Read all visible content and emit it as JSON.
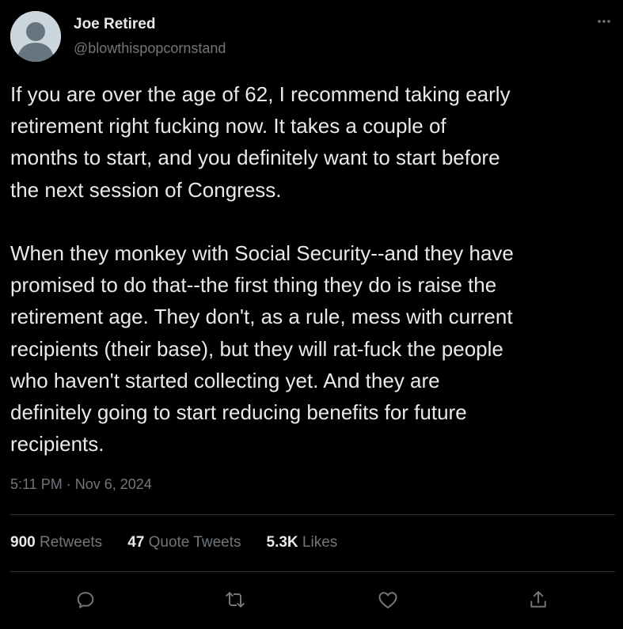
{
  "author": {
    "display_name": "Joe Retired",
    "handle": "@blowthispopcornstand",
    "avatar_icon": "default-avatar-icon"
  },
  "tweet": {
    "text": "If you are over the age of 62, I recommend taking early\nretirement right fucking now. It takes a couple of\nmonths to start, and you definitely want to start before\nthe next session of Congress.\n\nWhen they monkey with Social Security--and they have\npromised to do that--the first thing they do is raise the\nretirement age. They don't, as a rule, mess with current\nrecipients (their base), but they will rat-fuck the people\nwho haven't started collecting yet. And they are\ndefinitely going to start reducing benefits for future\nrecipients.",
    "timestamp": "5:11 PM · Nov 6, 2024"
  },
  "stats": {
    "retweets_count": "900",
    "retweets_label": "Retweets",
    "quotes_count": "47",
    "quotes_label": "Quote Tweets",
    "likes_count": "5.3K",
    "likes_label": "Likes"
  },
  "actions": {
    "reply_icon": "reply-icon",
    "retweet_icon": "retweet-icon",
    "like_icon": "heart-icon",
    "share_icon": "share-icon",
    "more_icon": "more-options-icon"
  },
  "colors": {
    "background": "#000000",
    "text_primary": "#e7e9ea",
    "text_secondary": "#71767b",
    "divider": "#2f3336",
    "avatar_bg": "#ccd6dd",
    "avatar_fg": "#66757f"
  }
}
